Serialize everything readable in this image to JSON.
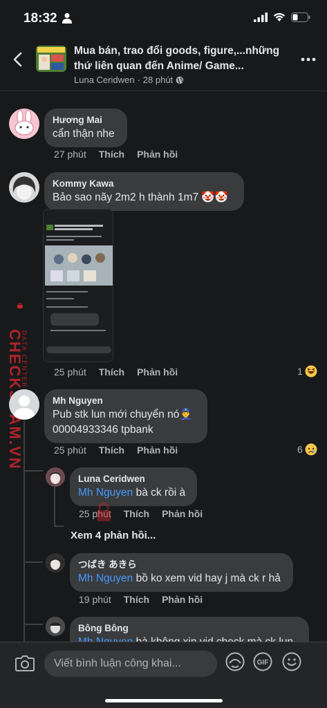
{
  "status": {
    "time": "18:32"
  },
  "header": {
    "title": "Mua bán, trao đổi goods, figure,...những thứ liên quan đến Anime/ Game...",
    "author": "Luna Ceridwen",
    "age": "28 phút"
  },
  "comments": [
    {
      "name": "Hương Mai",
      "text": "cẩn thận nhe",
      "time": "27 phút",
      "like": "Thích",
      "reply": "Phản hồi"
    },
    {
      "name": "Kommy Kawa",
      "text": "Bảo sao nãy 2m2 h thành 1m7 🤡🤡",
      "time": "25 phút",
      "like": "Thích",
      "reply": "Phản hồi",
      "reactions": "1"
    },
    {
      "name": "Mh Nguyen",
      "text1": "Pub stk lun mới chuyển nó👮",
      "text2": "00004933346 tpbank",
      "time": "25 phút",
      "like": "Thích",
      "reply": "Phản hồi",
      "reactions": "6"
    }
  ],
  "replies": [
    {
      "name": "Luna Ceridwen",
      "mention": "Mh Nguyen",
      "text": " bà ck rồi à",
      "time": "25 phút",
      "like": "Thích",
      "reply": "Phản hồi"
    },
    {
      "name": "つばき あきら",
      "mention": "Mh Nguyen",
      "text": " bồ ko xem vid hay j mà ck r hả",
      "time": "19 phút",
      "like": "Thích",
      "reply": "Phản hồi"
    },
    {
      "name": "Bông Bông",
      "mention": "Mh Nguyen",
      "text": " bà không xin vid check mà ck lun"
    }
  ],
  "see_more": "Xem 4 phản hồi...",
  "composer": {
    "placeholder": "Viết bình luận công khai..."
  },
  "watermark": {
    "main": "CHECKSCAM.VN",
    "sub": "DATA CENTER"
  },
  "colors": {
    "background": "#18191a",
    "bubble": "#3a3b3c",
    "mention": "#4599ff",
    "watermark": "#c9262e"
  }
}
